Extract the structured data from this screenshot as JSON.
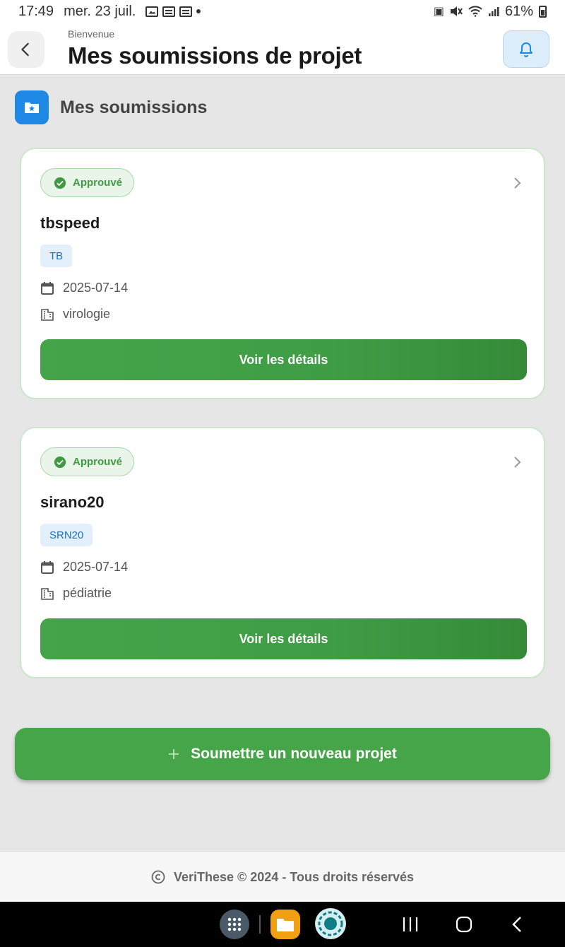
{
  "status_bar": {
    "time": "17:49",
    "date": "mer. 23 juil.",
    "battery": "61%"
  },
  "header": {
    "subtitle": "Bienvenue",
    "title": "Mes soumissions de projet"
  },
  "section": {
    "title": "Mes soumissions"
  },
  "submissions": [
    {
      "status": "Approuvé",
      "name": "tbspeed",
      "code": "TB",
      "date": "2025-07-14",
      "department": "virologie",
      "button": "Voir les détails"
    },
    {
      "status": "Approuvé",
      "name": "sirano20",
      "code": "SRN20",
      "date": "2025-07-14",
      "department": "pédiatrie",
      "button": "Voir les détails"
    }
  ],
  "new_project_button": "Soumettre un nouveau projet",
  "footer": {
    "text": "VeriThese © 2024 - Tous droits réservés"
  },
  "colors": {
    "primary_green": "#46a449",
    "accent_blue": "#1e88e5",
    "badge_green": "#3f9a43"
  }
}
